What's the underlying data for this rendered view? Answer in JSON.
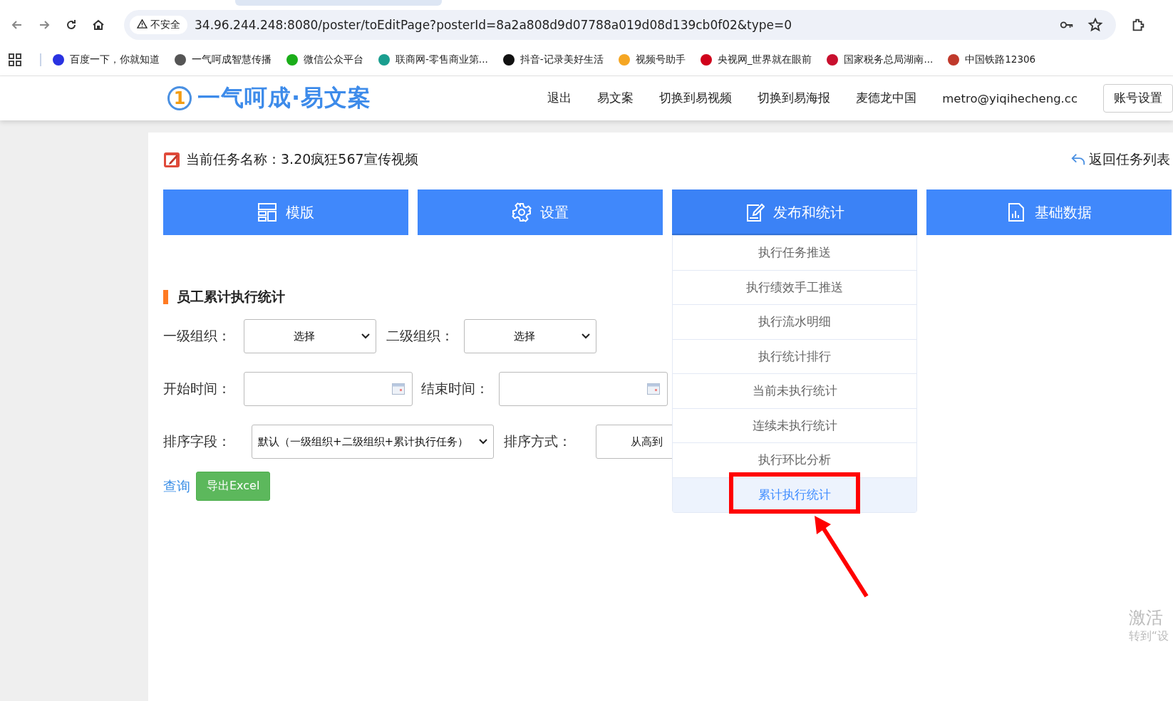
{
  "browser": {
    "security_label": "不安全",
    "url": "34.96.244.248:8080/poster/toEditPage?posterId=8a2a808d9d07788a019d08d139cb0f02&type=0",
    "bookmarks": [
      {
        "label": "百度一下，你就知道",
        "color": "#2932e1"
      },
      {
        "label": "一气呵成智慧传播",
        "color": "#555555"
      },
      {
        "label": "微信公众平台",
        "color": "#1aad19"
      },
      {
        "label": "联商网-零售商业第...",
        "color": "#1a9e8f"
      },
      {
        "label": "抖音-记录美好生活",
        "color": "#111111"
      },
      {
        "label": "视频号助手",
        "color": "#f5a623"
      },
      {
        "label": "央视网_世界就在眼前",
        "color": "#d0021b"
      },
      {
        "label": "国家税务总局湖南...",
        "color": "#c8102e"
      },
      {
        "label": "中国铁路12306",
        "color": "#c0392b"
      }
    ]
  },
  "header": {
    "logo_mark": "1",
    "logo_text": "一气呵成·易文案",
    "nav": [
      "退出",
      "易文案",
      "切换到易视频",
      "切换到易海报",
      "麦德龙中国",
      "metro@yiqihecheng.cc"
    ],
    "account_button": "账号设置"
  },
  "task": {
    "title": "当前任务名称：3.20疯狂567宣传视频",
    "back_link": "返回任务列表"
  },
  "tabs": [
    {
      "label": "模版",
      "kind": "layout",
      "expanded": false
    },
    {
      "label": "设置",
      "kind": "gear",
      "expanded": false
    },
    {
      "label": "发布和统计",
      "kind": "edit",
      "expanded": true,
      "menu": [
        {
          "label": "执行任务推送",
          "selected": false
        },
        {
          "label": "执行绩效手工推送",
          "selected": false
        },
        {
          "label": "执行流水明细",
          "selected": false
        },
        {
          "label": "执行统计排行",
          "selected": false
        },
        {
          "label": "当前未执行统计",
          "selected": false
        },
        {
          "label": "连续未执行统计",
          "selected": false
        },
        {
          "label": "执行环比分析",
          "selected": false
        },
        {
          "label": "累计执行统计",
          "selected": true
        }
      ]
    },
    {
      "label": "基础数据",
      "kind": "report",
      "expanded": false
    }
  ],
  "section_title": "员工累计执行统计",
  "filters": [
    [
      {
        "label": "一级组织：",
        "kind": "select",
        "value": "选择"
      },
      {
        "label": "二级组织：",
        "kind": "select",
        "value": "选择"
      }
    ],
    [
      {
        "label": "开始时间：",
        "kind": "date"
      },
      {
        "label": "结束时间：",
        "kind": "date"
      }
    ],
    [
      {
        "label": "排序字段：",
        "kind": "select",
        "value": "默认（一级组织+二级组织+累计执行任务）"
      },
      {
        "label": "排序方式：",
        "kind": "select",
        "value": "从高到"
      }
    ]
  ],
  "actions": {
    "query_link": "查询",
    "export_button": "导出Excel"
  },
  "os_notice": [
    "激活",
    "转到“设"
  ]
}
